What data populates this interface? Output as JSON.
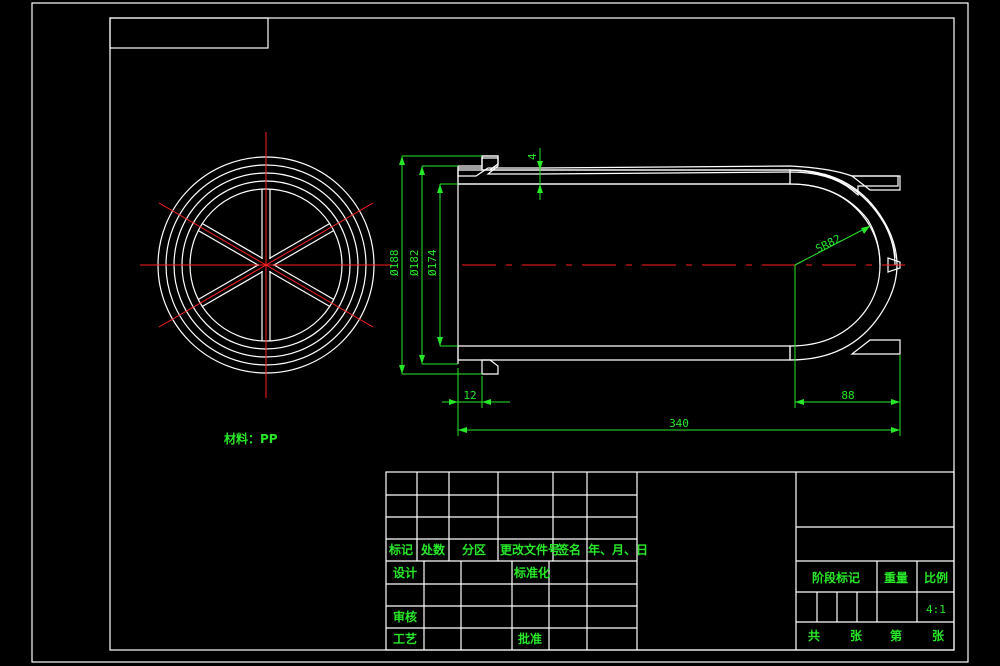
{
  "colors": {
    "background": "#000000",
    "outline": "#ffffff",
    "centerline": "#ff2020",
    "dimension": "#27e827",
    "hatch": "#36d6c8"
  },
  "material_note": "材料：PP",
  "dimensions": {
    "outer_diameter": "Ø188",
    "middle_diameter": "Ø182",
    "inner_diameter": "Ø174",
    "wall_thickness": "4",
    "flange_offset": "12",
    "total_length": "340",
    "dome_length": "88",
    "dome_radius": "SR82"
  },
  "title_block": {
    "headers": {
      "mark": "标记",
      "count": "处数",
      "zone": "分区",
      "change_doc": "更改文件号",
      "signature": "签名",
      "date": "年、月、日"
    },
    "design": "设计",
    "standardization": "标准化",
    "review": "审核",
    "process": "工艺",
    "approve": "批准",
    "stage_mark": "阶段标记",
    "weight": "重量",
    "scale_label": "比例",
    "scale_value": "4:1",
    "total": "共",
    "sheet": "张",
    "number": "第",
    "sheet2": "张"
  }
}
